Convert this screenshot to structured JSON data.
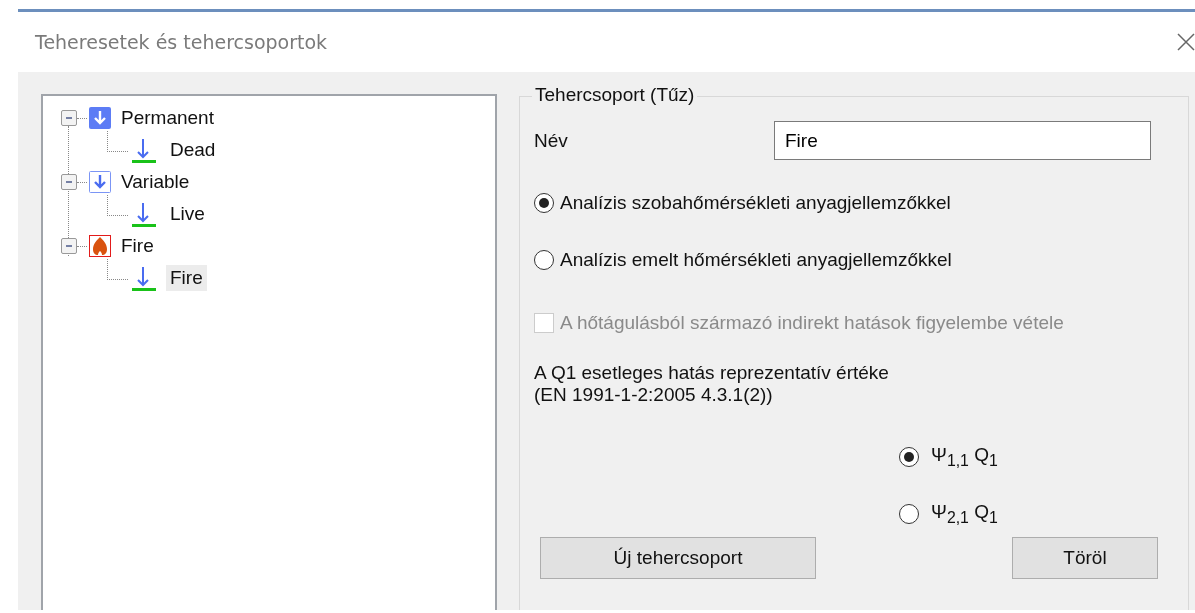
{
  "window": {
    "title": "Teheresetek és tehercsoportok"
  },
  "tree": [
    {
      "label": "Permanent",
      "kind": "permanent",
      "expanded": true,
      "children": [
        {
          "label": "Dead",
          "selected": false
        }
      ]
    },
    {
      "label": "Variable",
      "kind": "variable",
      "expanded": true,
      "children": [
        {
          "label": "Live",
          "selected": false
        }
      ]
    },
    {
      "label": "Fire",
      "kind": "fire",
      "expanded": true,
      "children": [
        {
          "label": "Fire",
          "selected": true
        }
      ]
    }
  ],
  "group": {
    "legend": "Tehercsoport (Tűz)",
    "name_label": "Név",
    "name_value": "Fire",
    "analysis_options": [
      {
        "label": "Analízis szobahőmérsékleti anyagjellemzőkkel",
        "selected": true
      },
      {
        "label": "Analízis emelt hőmérsékleti anyagjellemzőkkel",
        "selected": false
      }
    ],
    "indirect_effects": {
      "label": "A hőtágulásból származó indirekt hatások figyelembe vétele",
      "checked": false,
      "disabled": true
    },
    "note": "A Q1 esetleges hatás reprezentatív értéke\n(EN 1991-1-2:2005 4.3.1(2))",
    "psi_options": [
      {
        "label": "Ψ$_{1,1}$ Q$_{1}$",
        "selected": true
      },
      {
        "label": "Ψ$_{2,1}$ Q$_{1}$",
        "selected": false
      }
    ],
    "buttons": [
      "Új tehercsoport",
      "Töröl"
    ]
  }
}
